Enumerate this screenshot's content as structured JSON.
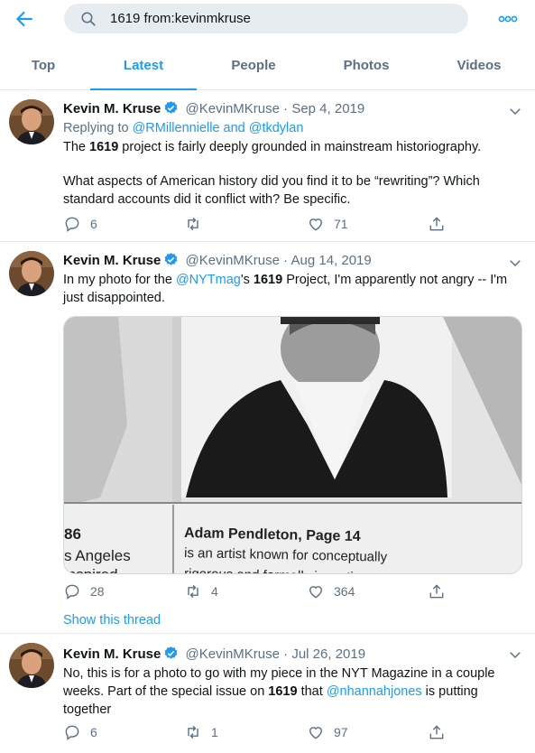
{
  "search": {
    "query": "1619 from:kevinmkruse"
  },
  "tabs": [
    {
      "label": "Top"
    },
    {
      "label": "Latest"
    },
    {
      "label": "People"
    },
    {
      "label": "Photos"
    },
    {
      "label": "Videos"
    }
  ],
  "tweets": [
    {
      "name": "Kevin M. Kruse",
      "handle": "@KevinMKruse",
      "dot": "·",
      "date": "Sep 4, 2019",
      "reply_prefix": "Replying to ",
      "reply_users": "@RMillennielle and @tkdylan",
      "p1_a": "The ",
      "p1_b": "1619",
      "p1_c": " project is fairly deeply grounded in mainstream historiography.",
      "p2": "What aspects of American history did you find it to be “rewriting”? Which standard accounts did it conflict with? Be specific.",
      "replies": "6",
      "retweets": "",
      "likes": "71"
    },
    {
      "name": "Kevin M. Kruse",
      "handle": "@KevinMKruse",
      "dot": "·",
      "date": "Aug 14, 2019",
      "t_a": "In my photo for the ",
      "t_link": "@NYTmag",
      "t_b": "'s ",
      "t_c": "1619",
      "t_d": " Project, I'm apparently not angry -- I'm just disappointed.",
      "photo": {
        "left_num": "86",
        "left_city": "s Angeles",
        "left_cut": "inspired",
        "caption_title": "Adam Pendleton, Page 14",
        "caption_line1": "is an artist known for conceptually",
        "caption_line2": "rigorous and formally inventive"
      },
      "replies": "28",
      "retweets": "4",
      "likes": "364",
      "show_thread": "Show this thread"
    },
    {
      "name": "Kevin M. Kruse",
      "handle": "@KevinMKruse",
      "dot": "·",
      "date": "Jul 26, 2019",
      "t_a": "No, this is for a photo to go with my piece in the NYT Magazine in a couple weeks. Part of the special issue on ",
      "t_b": "1619",
      "t_c": " that ",
      "t_link": "@nhannahjones",
      "t_d": " is putting together",
      "replies": "6",
      "retweets": "1",
      "likes": "97"
    }
  ],
  "colors": {
    "accent": "#1d9bf0",
    "muted": "#5b7083",
    "text": "#0f1419",
    "divider": "#e6ecf0"
  }
}
